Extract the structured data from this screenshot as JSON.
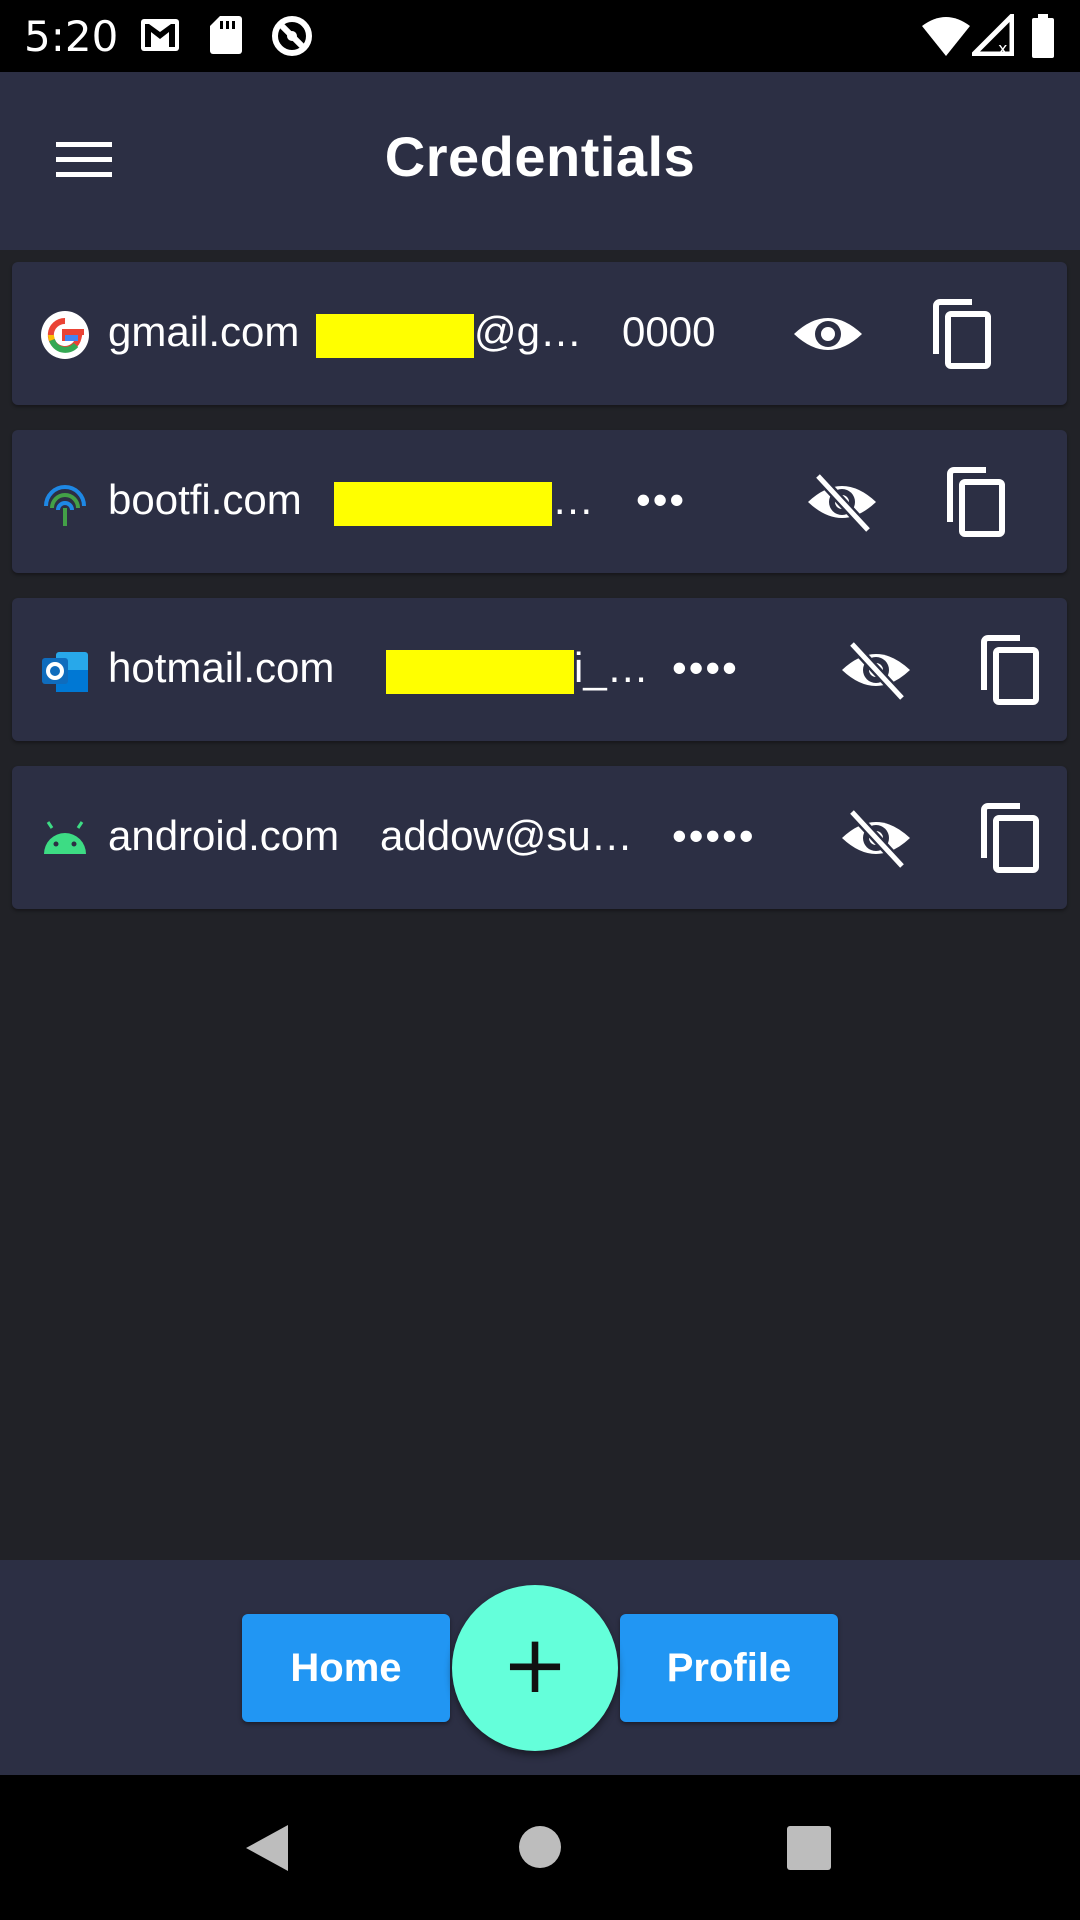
{
  "status_bar": {
    "time": "5:20",
    "icons_left": [
      "gmail-icon",
      "sd-card-icon",
      "sync-disabled-icon"
    ],
    "icons_right": [
      "wifi-icon",
      "signal-no-data-icon",
      "battery-icon"
    ]
  },
  "app_bar": {
    "title": "Credentials",
    "menu_icon": "hamburger-menu-icon"
  },
  "credentials": [
    {
      "domain": "gmail.com",
      "username": "@g…",
      "password": "0000",
      "visible": true,
      "favicon": "google-icon"
    },
    {
      "domain": "bootfi.com",
      "username": "…",
      "password": "•••",
      "visible": false,
      "favicon": "bootfi-icon"
    },
    {
      "domain": "hotmail.com",
      "username": "i_…",
      "password": "••••",
      "visible": false,
      "favicon": "outlook-icon"
    },
    {
      "domain": "android.com",
      "username": "addow@su…",
      "password": "•••••",
      "visible": false,
      "favicon": "android-icon"
    }
  ],
  "bottom_nav": {
    "home_label": "Home",
    "profile_label": "Profile",
    "fab_label": "+"
  },
  "colors": {
    "background": "#212227",
    "surface": "#2c2f44",
    "primary_button": "#2196f3",
    "fab": "#64ffda",
    "redaction": "#ffff00"
  }
}
